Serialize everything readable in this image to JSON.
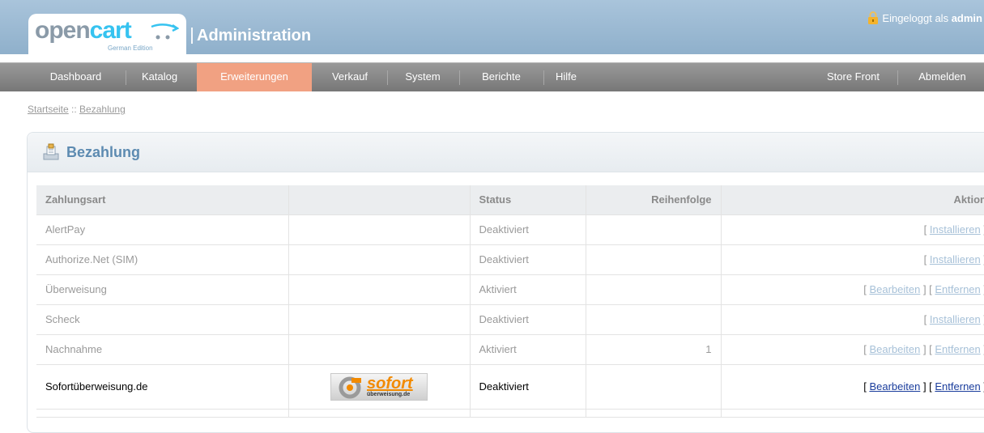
{
  "header": {
    "logo_open": "open",
    "logo_cart": "cart",
    "logo_sub": "German Edition",
    "title": "Administration",
    "login_prefix": "Eingeloggt als",
    "login_user": "admin"
  },
  "nav": {
    "left": [
      "Dashboard",
      "Katalog",
      "Erweiterungen",
      "Verkauf",
      "System",
      "Berichte",
      "Hilfe"
    ],
    "active": "Erweiterungen",
    "right": [
      "Store Front",
      "Abmelden"
    ]
  },
  "breadcrumb": {
    "home": "Startseite",
    "separator": " :: ",
    "current": "Bezahlung"
  },
  "panel": {
    "title": "Bezahlung"
  },
  "table": {
    "headers": {
      "name": "Zahlungsart",
      "image": "",
      "status": "Status",
      "order": "Reihenfolge",
      "action": "Aktion"
    },
    "rows": [
      {
        "name": "AlertPay",
        "status": "Deaktiviert",
        "order": "",
        "actions": [
          "Installieren"
        ]
      },
      {
        "name": "Authorize.Net (SIM)",
        "status": "Deaktiviert",
        "order": "",
        "actions": [
          "Installieren"
        ]
      },
      {
        "name": "Überweisung",
        "status": "Aktiviert",
        "order": "",
        "actions": [
          "Bearbeiten",
          "Entfernen"
        ]
      },
      {
        "name": "Scheck",
        "status": "Deaktiviert",
        "order": "",
        "actions": [
          "Installieren"
        ]
      },
      {
        "name": "Nachnahme",
        "status": "Aktiviert",
        "order": "1",
        "actions": [
          "Bearbeiten",
          "Entfernen"
        ]
      },
      {
        "name": "Sofortüberweisung.de",
        "status": "Deaktiviert",
        "order": "",
        "actions": [
          "Bearbeiten",
          "Entfernen"
        ],
        "logo_word": "sofort",
        "logo_sub": "überweisung.de"
      }
    ]
  },
  "colors": {
    "header_bg": "#9ab8d1",
    "nav_bg": "#888888",
    "nav_active": "#f1a182",
    "panel_title": "#5d8bb1",
    "link_muted": "#a7c1d8",
    "link_active": "#1a3d9c",
    "logo_accent": "#f28a00"
  }
}
